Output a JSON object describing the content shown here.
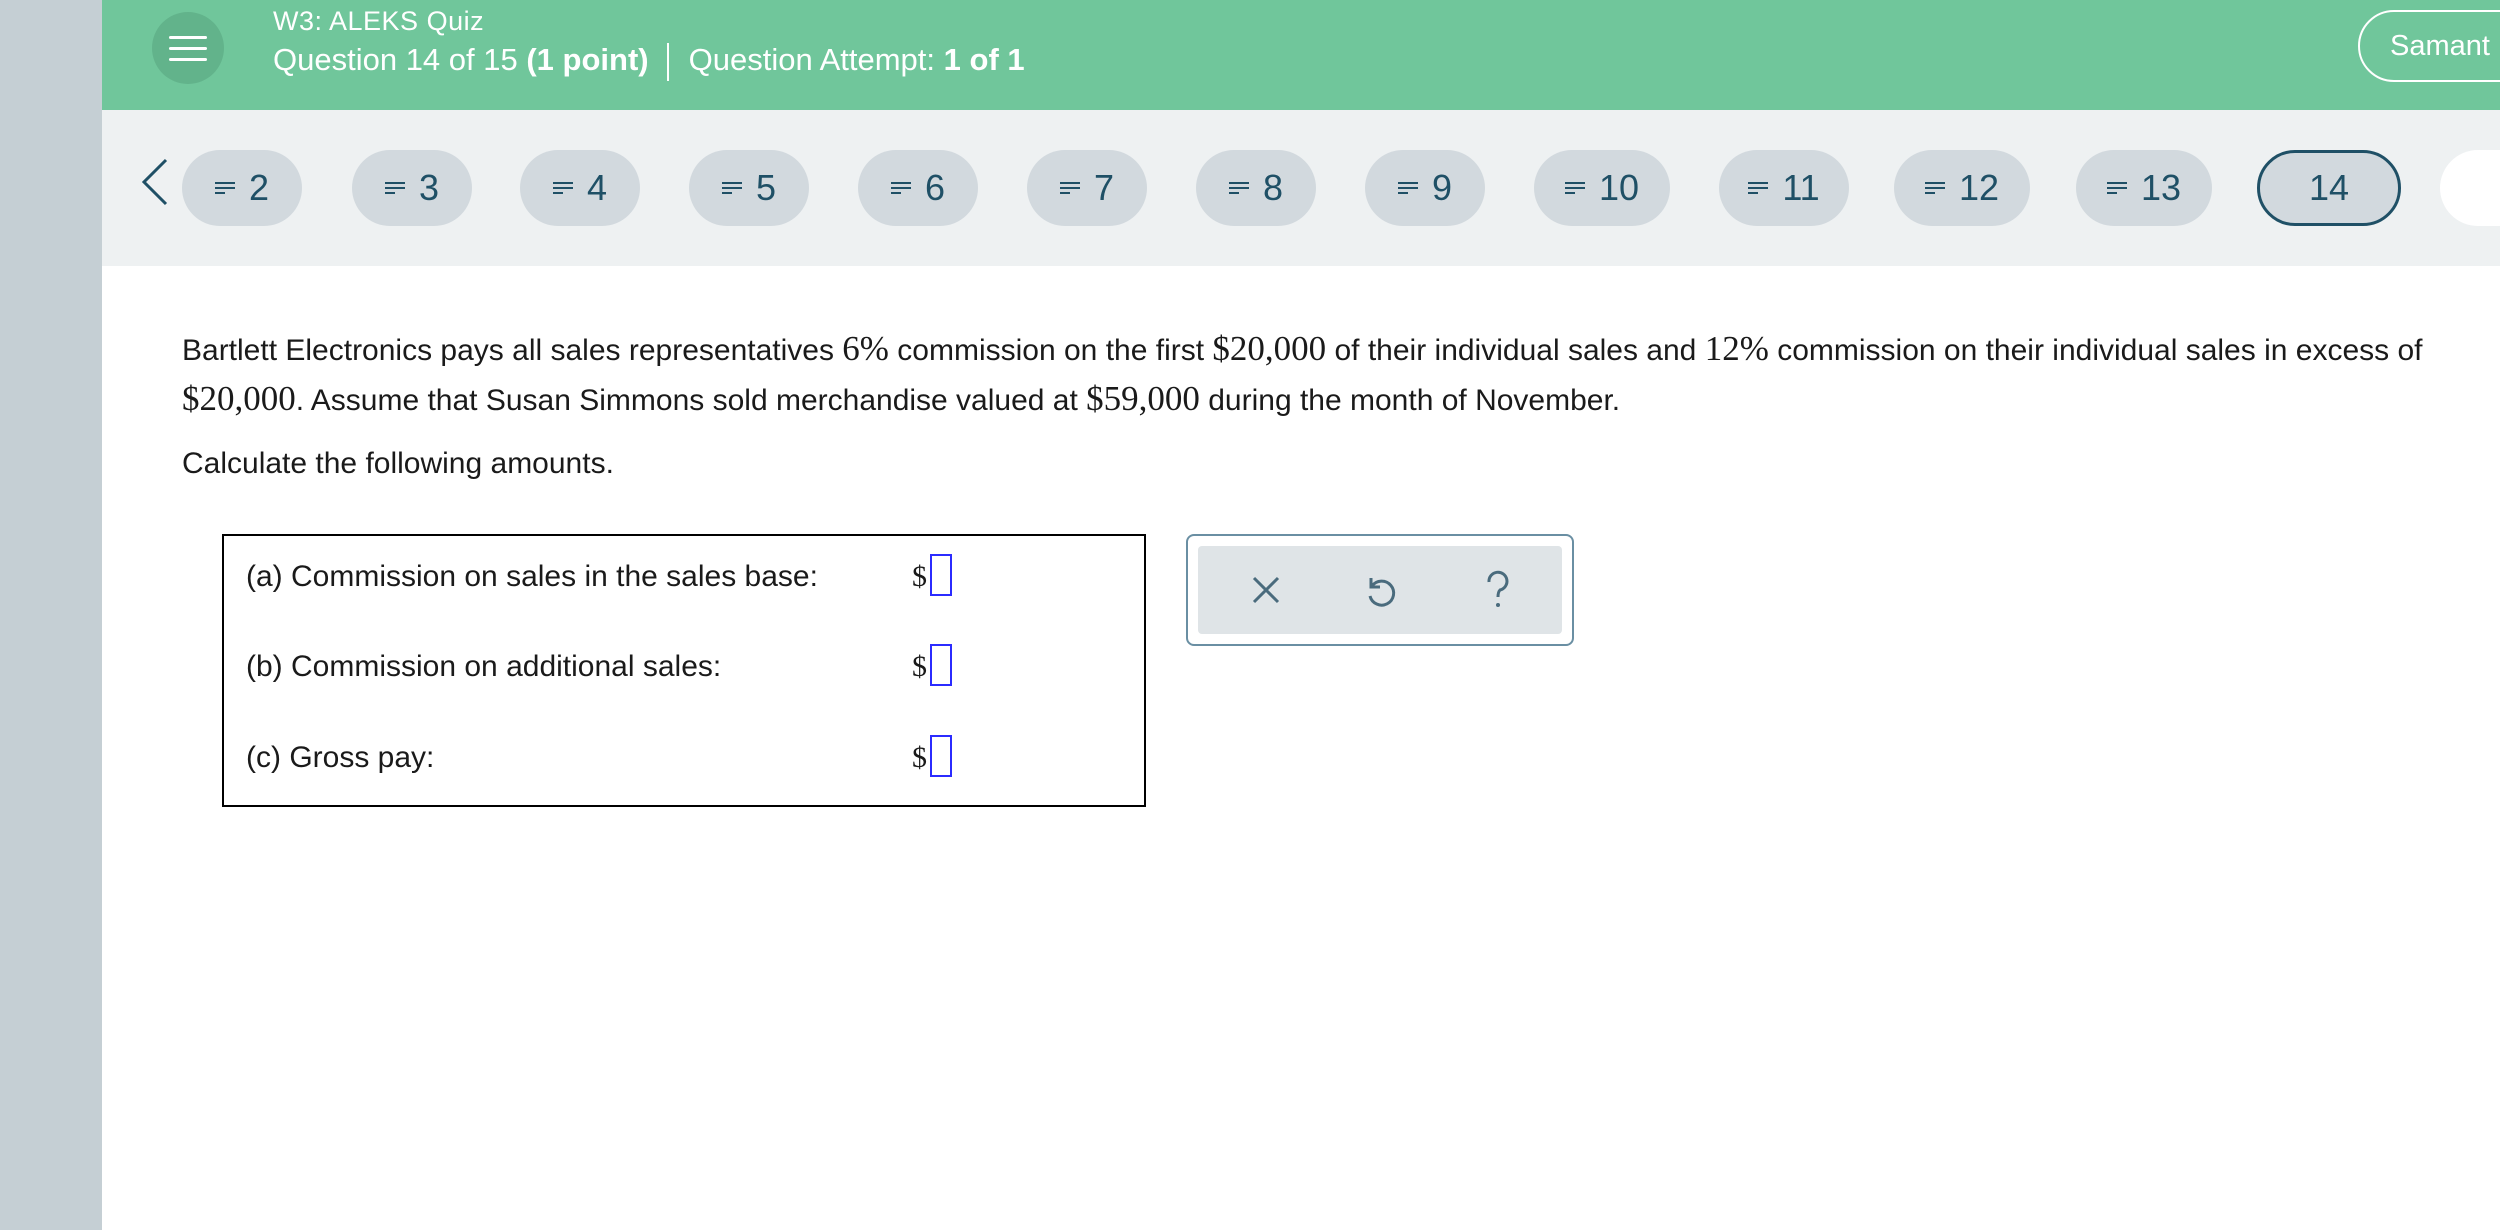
{
  "header": {
    "quiz_title": "W3: ALEKS Quiz",
    "question_label": "Question 14 of 15",
    "points": "(1 point)",
    "attempt_label": "Question Attempt:",
    "attempt_value": "1 of 1",
    "user_name": "Samant"
  },
  "nav": {
    "questions": [
      "2",
      "3",
      "4",
      "5",
      "6",
      "7",
      "8",
      "9",
      "10",
      "11",
      "12",
      "13"
    ],
    "current": "14"
  },
  "problem": {
    "p1": "Bartlett Electronics pays all sales representatives ",
    "rate1": "6%",
    "p2": " commission on the first ",
    "base": "$20,000",
    "p3": " of their individual sales and ",
    "rate2": "12%",
    "p4": " commission on their individual sales in excess of ",
    "base2": "$20,000",
    "p5": ". Assume that Susan Simmons sold merchandise valued at ",
    "sold": "$59,000",
    "p6": " during the month of November.",
    "instruction": "Calculate the following amounts."
  },
  "answers": {
    "a_label": "(a) Commission on sales in the sales base:",
    "b_label": "(b) Commission on additional sales:",
    "c_label": "(c) Gross pay:",
    "currency": "$"
  },
  "tools": {
    "clear_icon": "close-icon",
    "undo_icon": "undo-icon",
    "help_icon": "help-icon"
  },
  "colors": {
    "header_bg": "#70c69b",
    "pill_bg": "#d2d9de",
    "pill_text": "#1f5066",
    "input_border": "#2b2bff"
  }
}
